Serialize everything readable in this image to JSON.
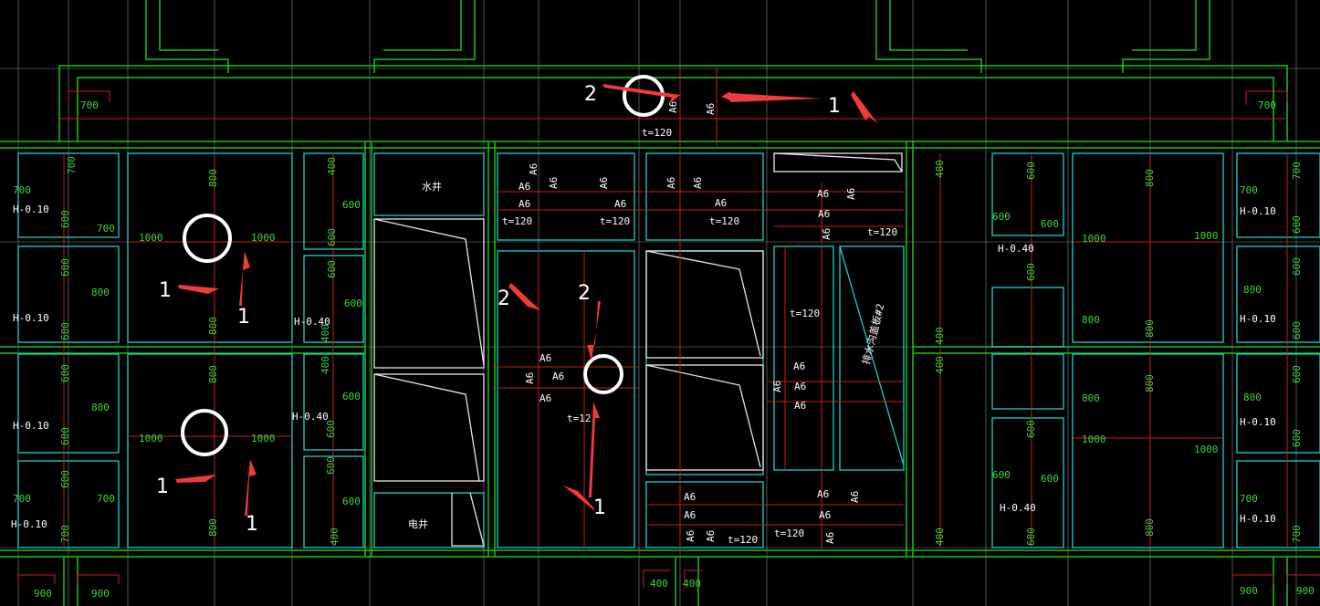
{
  "drawing": {
    "room_labels": {
      "water_well": "水井",
      "elec_well": "电井",
      "pipe_label": "排水沟盖板#2"
    },
    "dims": {
      "d400": "400",
      "d600": "600",
      "d700": "700",
      "d800": "800",
      "d900": "900",
      "d1000": "1000"
    },
    "levels": {
      "h010": "H-0.10",
      "h040": "H-0.40"
    },
    "rebar": {
      "a6": "A6",
      "t120": "t=120",
      "t12": "t=12"
    },
    "markers": {
      "one": "1",
      "two": "2"
    }
  }
}
